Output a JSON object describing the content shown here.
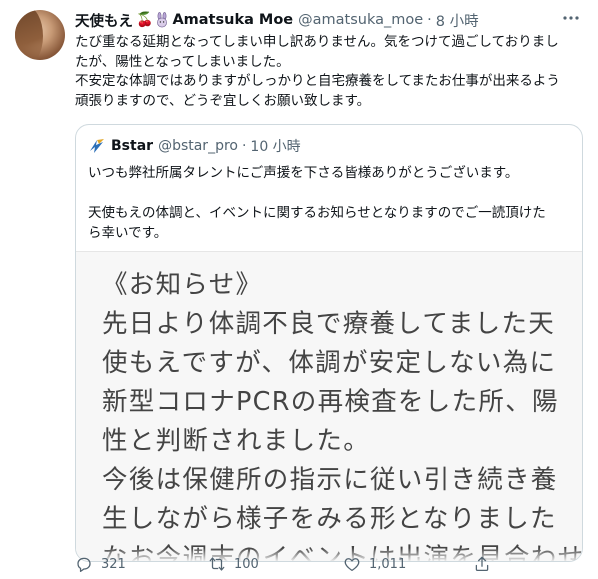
{
  "tweet": {
    "display_name": "天使もえ",
    "emoji_cherry": "🍒",
    "name_suffix": "Amatsuka Moe",
    "handle": "@amatsuka_moe",
    "dot": "·",
    "time": "8 小時",
    "lines": [
      "たび重なる延期となってしまい申し訳ありません。気をつけて過ごしておりまし",
      "たが、陽性となってしまいました。",
      "不安定な体調ではありますがしっかりと自宅療養をしてまたお仕事が出来るよう",
      "頑張りますので、どうぞ宜しくお願い致します。"
    ]
  },
  "quote": {
    "name": "Bstar",
    "handle": "@bstar_pro",
    "dot": "·",
    "time": "10 小時",
    "line1": "いつも弊社所属タレントにご声援を下さる皆様ありがとうございます。",
    "line2": "天使もえの体調と、イベントに関するお知らせとなりますのでご一読頂けた",
    "line3": "ら幸いです。",
    "notice_lines": [
      "《お知らせ》",
      "先日より体調不良で療養してました天",
      "使もえですが、体調が安定しない為に",
      "新型コロナPCRの再検査をした所、陽",
      "性と判断されました。",
      "今後は保健所の指示に従い引き続き養",
      "生しながら様子をみる形となりました",
      "なお今週末のイベントは出演を見合わせ"
    ]
  },
  "actions": {
    "reply_count": "321",
    "retweet_count": "100",
    "like_count": "1,011"
  },
  "colors": {
    "text": "#0f1419",
    "secondary": "#536471",
    "border": "#cfd9de"
  }
}
